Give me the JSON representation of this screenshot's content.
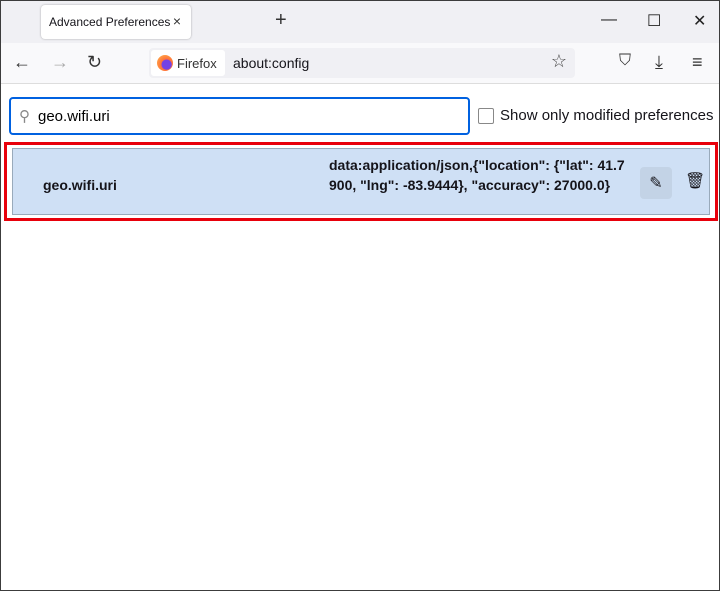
{
  "tab": {
    "title": "Advanced Preferences",
    "close": "×",
    "new": "+"
  },
  "window": {
    "minimize": "—",
    "maximize": "☐",
    "close": "✕"
  },
  "nav": {
    "back": "←",
    "forward": "→",
    "reload": "↻",
    "identity": "Firefox",
    "url": "about:config",
    "star": "☆",
    "pocket": "⛉",
    "download": "⤓",
    "menu": "≡"
  },
  "search": {
    "icon": "⚲",
    "value": "geo.wifi.uri"
  },
  "filter": {
    "label": "Show only modified preferences",
    "checked": false
  },
  "preference": {
    "name": "geo.wifi.uri",
    "value": "data:application/json,{\"location\": {\"lat\": 41.7900, \"lng\": -83.9444}, \"accuracy\": 27000.0}",
    "edit": "✎",
    "delete": "🗑"
  },
  "colors": {
    "highlight": "#e8000b",
    "row": "#cfe0f5",
    "focus": "#0061e0"
  }
}
